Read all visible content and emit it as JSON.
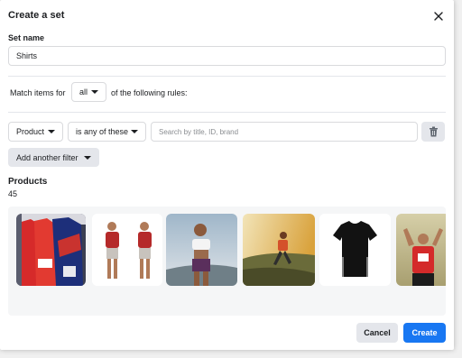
{
  "dialog": {
    "title": "Create a set",
    "close_icon": "close-icon"
  },
  "set_name": {
    "label": "Set name",
    "value": "Shirts"
  },
  "match": {
    "prefix": "Match items for",
    "selected": "all",
    "suffix": "of the following rules:"
  },
  "rule": {
    "field": "Product",
    "operator": "is any of these",
    "search_placeholder": "Search by title, ID, brand",
    "delete_icon": "trash-icon"
  },
  "add_filter_label": "Add another filter",
  "products": {
    "heading": "Products",
    "count": "45",
    "items": [
      {
        "name": "red-and-blue-jerseys-on-rack"
      },
      {
        "name": "man-in-red-tshirt-two-poses"
      },
      {
        "name": "woman-in-white-crop-top"
      },
      {
        "name": "runner-at-sunset"
      },
      {
        "name": "black-tshirt-with-stripes"
      },
      {
        "name": "runner-in-red-cheering"
      }
    ]
  },
  "footer": {
    "cancel_label": "Cancel",
    "create_label": "Create"
  },
  "colors": {
    "primary": "#1877f2",
    "secondary_button": "#e4e6eb",
    "text": "#1c1e21",
    "placeholder": "#8a8d91"
  }
}
